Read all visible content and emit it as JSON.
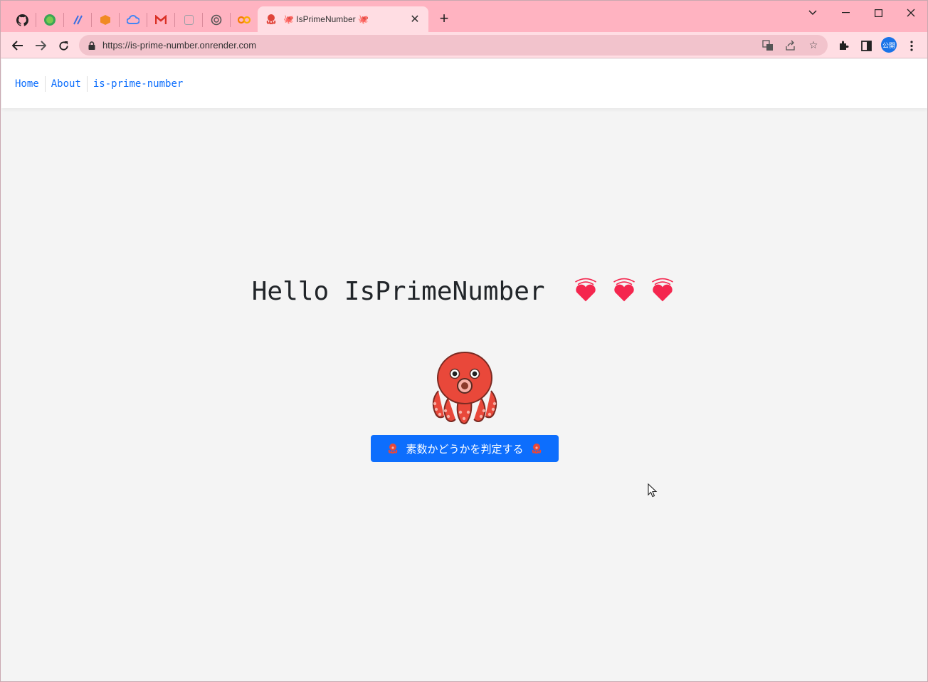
{
  "browser": {
    "pinned_tabs": [
      {
        "icon": "github-icon",
        "color": "#222222"
      },
      {
        "icon": "green-circle-icon",
        "color": "#3aa655"
      },
      {
        "icon": "slash-app-icon",
        "color": "#3c6fe0"
      },
      {
        "icon": "orange-box-icon",
        "color": "#f08a24"
      },
      {
        "icon": "cloud-icon",
        "color": "#4285f4"
      },
      {
        "icon": "gmail-icon",
        "color": "#d93025"
      },
      {
        "icon": "notebook-icon",
        "color": "#9aa0a6"
      },
      {
        "icon": "openai-icon",
        "color": "#555555"
      },
      {
        "icon": "colab-icon",
        "color": "#f57c00"
      }
    ],
    "active_tab": {
      "title": "🐙 IsPrimeNumber 🐙"
    },
    "address": {
      "url": "https://is-prime-number.onrender.com"
    },
    "profile_label": "公開",
    "accent": "#ffb3c1"
  },
  "site": {
    "nav": [
      {
        "label": "Home"
      },
      {
        "label": "About"
      },
      {
        "label": "is-prime-number"
      }
    ],
    "title": "Hello IsPrimeNumber",
    "button_label": "素数かどうかを判定する",
    "button_color": "#0d6efd",
    "heart_color": "#f4264e",
    "octopus_color": "#e9483a"
  }
}
